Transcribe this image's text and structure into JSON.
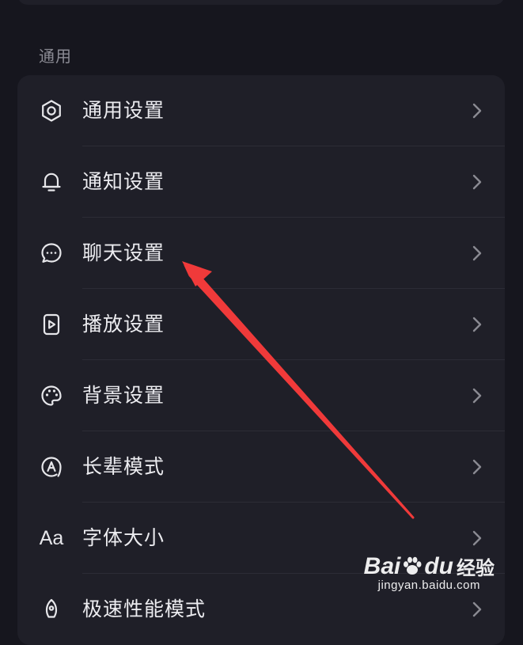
{
  "section": {
    "title": "通用"
  },
  "settings": {
    "items": [
      {
        "label": "通用设置",
        "icon": "gear-icon"
      },
      {
        "label": "通知设置",
        "icon": "bell-icon"
      },
      {
        "label": "聊天设置",
        "icon": "chat-bubble-icon"
      },
      {
        "label": "播放设置",
        "icon": "play-icon"
      },
      {
        "label": "背景设置",
        "icon": "palette-icon"
      },
      {
        "label": "长辈模式",
        "icon": "elder-mode-icon"
      },
      {
        "label": "字体大小",
        "icon": "font-size-icon",
        "icon_text": "Aa"
      },
      {
        "label": "极速性能模式",
        "icon": "rocket-icon"
      }
    ]
  },
  "colors": {
    "background": "#16161e",
    "card": "#1f1f28",
    "divider": "#2c2c36",
    "arrow": "#f03a3a"
  },
  "watermark": {
    "brand_left": "Bai",
    "brand_right": "du",
    "jingyan": "经验",
    "url": "jingyan.baidu.com"
  }
}
